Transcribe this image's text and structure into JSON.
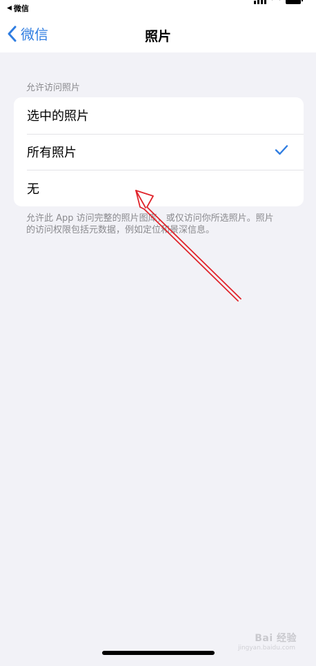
{
  "status_bar": {
    "back_app_label": "微信"
  },
  "nav": {
    "back_label": "微信",
    "title": "照片"
  },
  "photos_access": {
    "section_header": "允许访问照片",
    "options": [
      {
        "label": "选中的照片",
        "selected": false
      },
      {
        "label": "所有照片",
        "selected": true
      },
      {
        "label": "无",
        "selected": false
      }
    ],
    "footer_note": "允许此 App 访问完整的照片图库，或仅访问你所选照片。照片的访问权限包括元数据，例如定位和景深信息。"
  },
  "watermark": {
    "brand": "Bai 经验",
    "url": "jingyan.baidu.com"
  },
  "colors": {
    "accent": "#2f7de1",
    "annotation": "#e0242b",
    "background": "#f2f2f7"
  }
}
